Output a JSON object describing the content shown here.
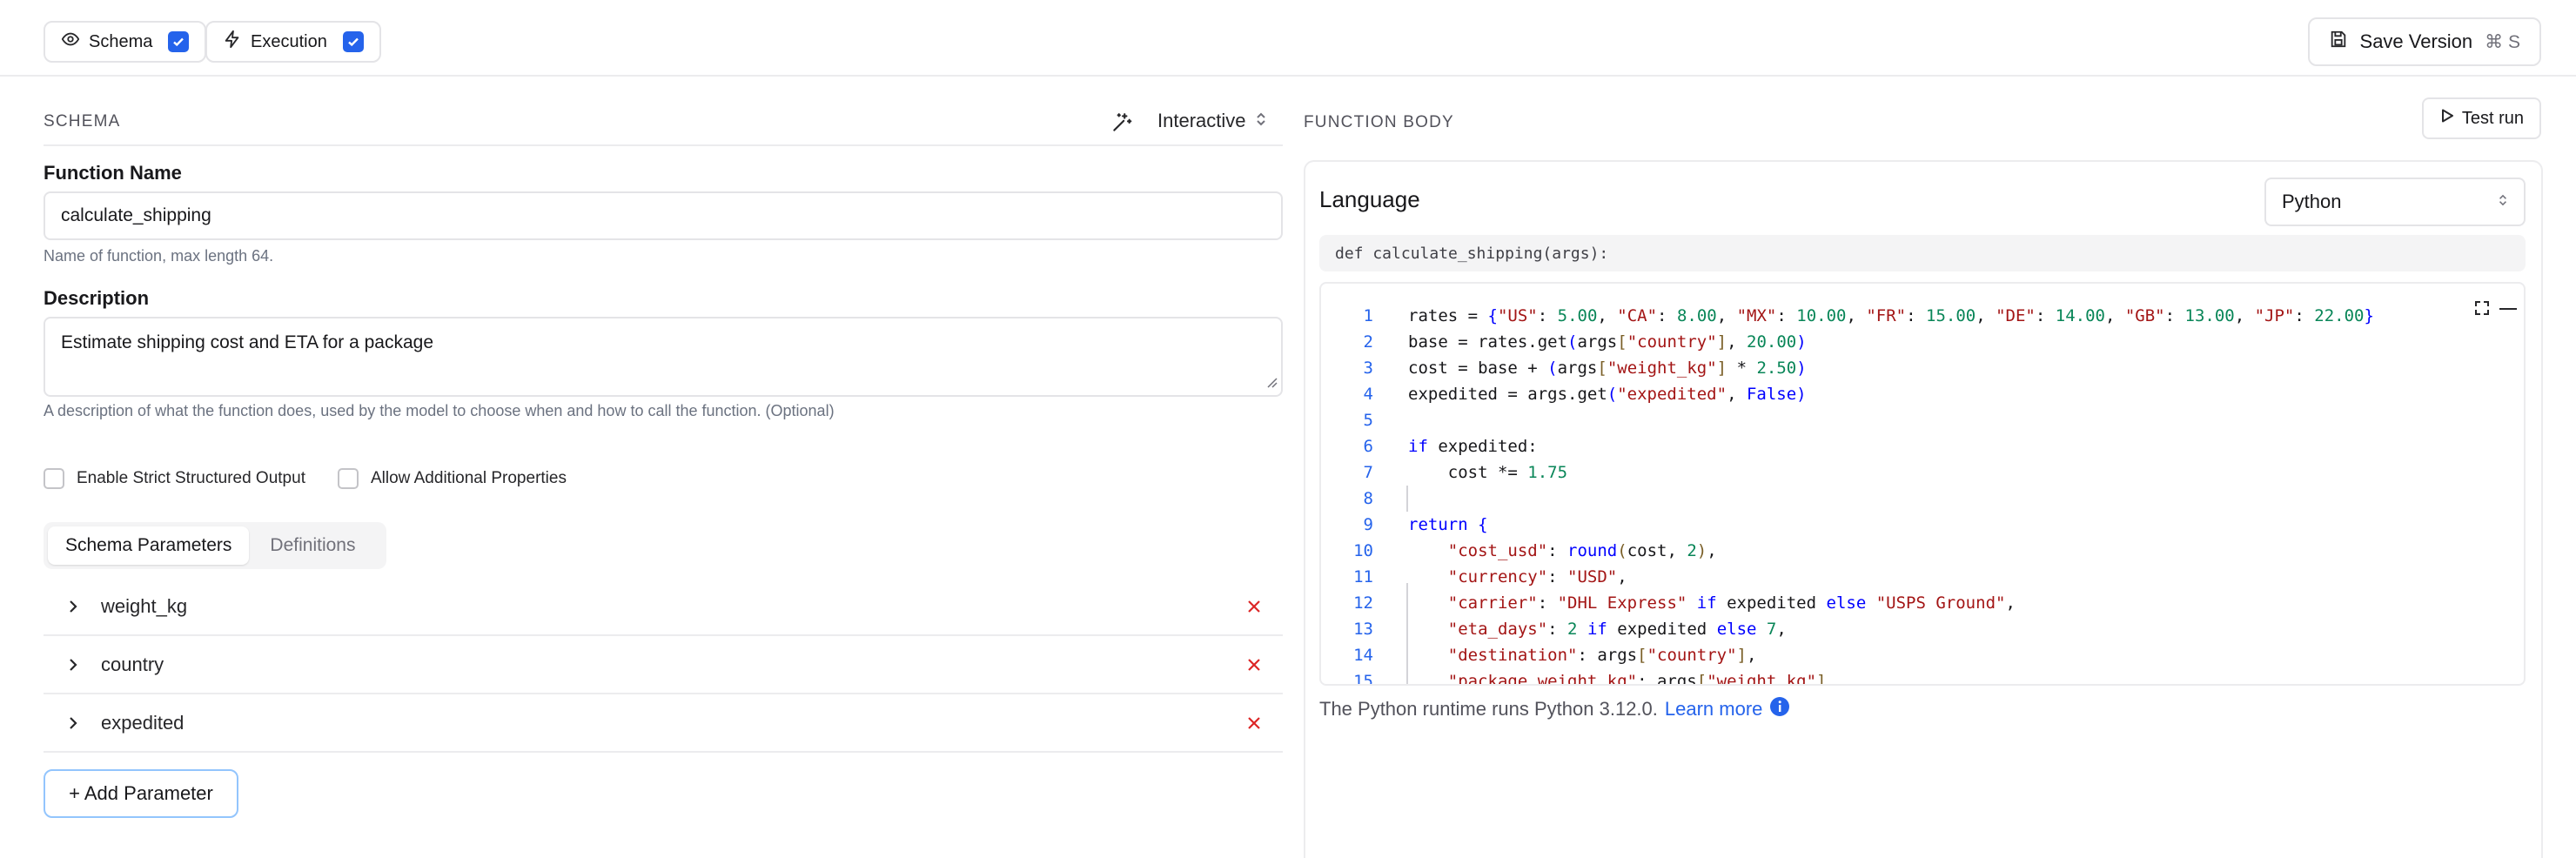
{
  "toolbar": {
    "schema_label": "Schema",
    "execution_label": "Execution",
    "schema_checked": true,
    "execution_checked": true,
    "save_label": "Save Version",
    "save_shortcut": "⌘ S"
  },
  "schema": {
    "section_title": "SCHEMA",
    "mode_label": "Interactive",
    "function_name_label": "Function Name",
    "function_name_value": "calculate_shipping",
    "function_name_help": "Name of function, max length 64.",
    "description_label": "Description",
    "description_value": "Estimate shipping cost and ETA for a package",
    "description_help": "A description of what the function does, used by the model to choose when and how to call the function. (Optional)",
    "strict_label": "Enable Strict Structured Output",
    "additional_label": "Allow Additional Properties",
    "tabs": [
      {
        "label": "Schema Parameters",
        "active": true
      },
      {
        "label": "Definitions",
        "active": false
      }
    ],
    "parameters": [
      {
        "name": "weight_kg"
      },
      {
        "name": "country"
      },
      {
        "name": "expedited"
      }
    ],
    "add_parameter_label": "+ Add Parameter"
  },
  "function_body": {
    "section_title": "FUNCTION BODY",
    "test_run_label": "Test run",
    "language_label": "Language",
    "language_value": "Python",
    "signature": "def calculate_shipping(args):",
    "line_numbers": [
      "1",
      "2",
      "3",
      "4",
      "5",
      "6",
      "7",
      "8",
      "9",
      "10",
      "11",
      "12",
      "13",
      "14",
      "15"
    ],
    "runtime_text": "The Python runtime runs Python 3.12.0.",
    "learn_more_label": "Learn more"
  },
  "colors": {
    "accent": "#2563eb",
    "delete": "#dc2626",
    "border": "#e4e4e7"
  }
}
